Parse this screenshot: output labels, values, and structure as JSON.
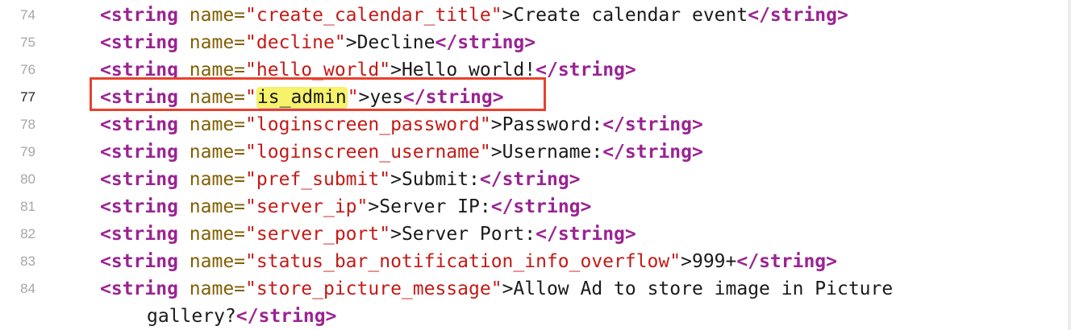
{
  "colors": {
    "tag": "#9b2393",
    "attribute": "#815f03",
    "string_value": "#c41a16",
    "text": "#1a1a1a",
    "line_number": "#a6a6a6",
    "highlight": "#f6f36b",
    "annotation_box": "#e8412c"
  },
  "tokens": {
    "open_tag": "<string",
    "attr_name": "name=",
    "quote": "\"",
    "close_bracket": ">",
    "end_tag": "</string>"
  },
  "lines": [
    {
      "number": "74",
      "name": "create_calendar_title",
      "text": "Create calendar event"
    },
    {
      "number": "75",
      "name": "decline",
      "text": "Decline"
    },
    {
      "number": "76",
      "name": "hello_world",
      "text": "Hello world!"
    },
    {
      "number": "77",
      "name": "is_admin",
      "text": "yes",
      "current": true,
      "highlighted": true
    },
    {
      "number": "78",
      "name": "loginscreen_password",
      "text": "Password:"
    },
    {
      "number": "79",
      "name": "loginscreen_username",
      "text": "Username:"
    },
    {
      "number": "80",
      "name": "pref_submit",
      "text": "Submit:"
    },
    {
      "number": "81",
      "name": "server_ip",
      "text": "Server IP:"
    },
    {
      "number": "82",
      "name": "server_port",
      "text": "Server Port:"
    },
    {
      "number": "83",
      "name": "status_bar_notification_info_overflow",
      "text": "999+"
    },
    {
      "number": "84",
      "name": "store_picture_message",
      "text": "Allow Ad to store image in Picture",
      "continuation": "gallery?"
    }
  ]
}
